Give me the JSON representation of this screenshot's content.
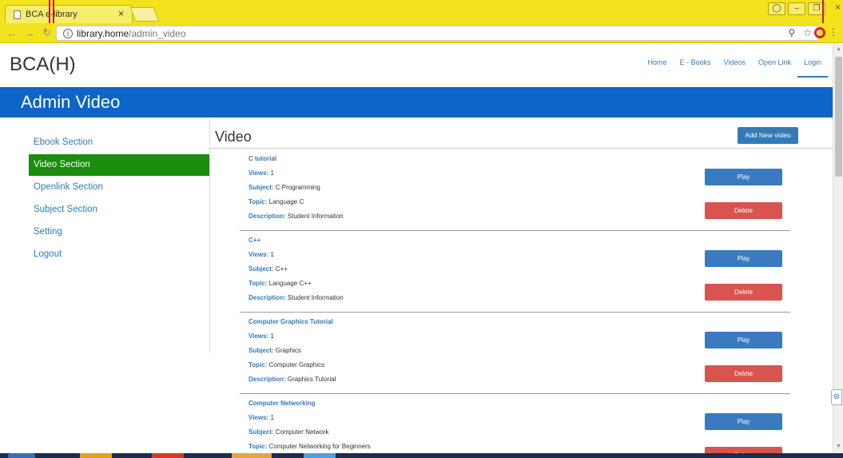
{
  "browser": {
    "tab_title": "BCA e-library",
    "tab_close": "×",
    "url_host": "library.home",
    "url_path": "/admin_video",
    "win_minimize": "–",
    "win_restore": "❐",
    "win_close": "×"
  },
  "header": {
    "brand": "BCA(H)",
    "nav": [
      "Home",
      "E - Books",
      "Videos",
      "Open Link",
      "Login"
    ]
  },
  "banner": {
    "title": "Admin Video"
  },
  "sidebar": {
    "items": [
      {
        "label": "Ebook Section"
      },
      {
        "label": "Video Section",
        "active": true
      },
      {
        "label": "Openlink Section"
      },
      {
        "label": "Subject Section"
      },
      {
        "label": "Setting"
      },
      {
        "label": "Logout"
      }
    ]
  },
  "main": {
    "title": "Video",
    "add_button": "Add New video",
    "field_labels": {
      "views": "Views:",
      "subject": "Subject:",
      "topic": "Topic:",
      "description": "Description:"
    },
    "play_label": "Play",
    "delete_label": "Delete",
    "videos": [
      {
        "title": "C tutorial",
        "views": "1",
        "subject": "C Programming",
        "topic": "Language C",
        "description": "Student Information"
      },
      {
        "title": "C++",
        "views": "1",
        "subject": "C++",
        "topic": "Language C++",
        "description": "Student Information"
      },
      {
        "title": "Computer Graphics Tutorial",
        "views": "1",
        "subject": "Graphics",
        "topic": "Computer Graphics",
        "description": "Graphics Tutorial"
      },
      {
        "title": "Computer Networking",
        "views": "1",
        "subject": "Computer Network",
        "topic": "Computer Networking for Beginners",
        "description": ""
      }
    ]
  },
  "colors": {
    "banner": "#0d64c9",
    "active_sidebar": "#1a8c0e",
    "primary_button": "#337ab7",
    "danger_button": "#d9534f",
    "browser_chrome": "#f3e31c"
  }
}
